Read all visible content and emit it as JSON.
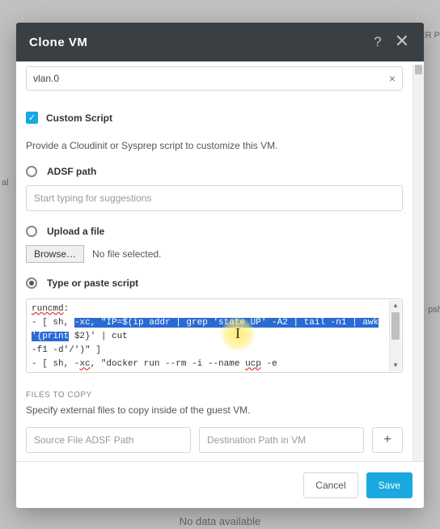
{
  "bg": {
    "right1": "LLER P",
    "left1": "al",
    "right2": "+",
    "right3": "pshot",
    "bottom": "No data available"
  },
  "modal": {
    "title": "Clone VM"
  },
  "vlan": {
    "value": "vlan.0"
  },
  "customScript": {
    "label": "Custom Script",
    "desc": "Provide a Cloudinit or Sysprep script to customize this VM."
  },
  "options": {
    "adsf": {
      "label": "ADSF path",
      "placeholder": "Start typing for suggestions"
    },
    "upload": {
      "label": "Upload a file",
      "browse": "Browse…",
      "nofile": "No file selected."
    },
    "type": {
      "label": "Type or paste script"
    }
  },
  "script": {
    "l1_a": "runcmd",
    "l1_b": ":",
    "l2_a": " - [ sh, ",
    "l2_hl": "-xc, \"IP=$(ip addr | grep 'state UP' -A2 | tail -n1 | awk '{print",
    "l2_b": " $2}' | cut ",
    "l3_a": "-f1  -d'/')\" ]",
    "l4_a": " - [ sh, -",
    "l4_b": "xc",
    "l4_c": ", \"docker run --rm -i  --name ",
    "l4_d": "ucp",
    "l4_e": "  -e UCP_ADMIN_USER=admin  -e "
  },
  "files": {
    "heading": "FILES TO COPY",
    "desc": "Specify external files to copy inside of the guest VM.",
    "srcPlaceholder": "Source File ADSF Path",
    "dstPlaceholder": "Destination Path in VM"
  },
  "footer": {
    "cancel": "Cancel",
    "save": "Save"
  }
}
